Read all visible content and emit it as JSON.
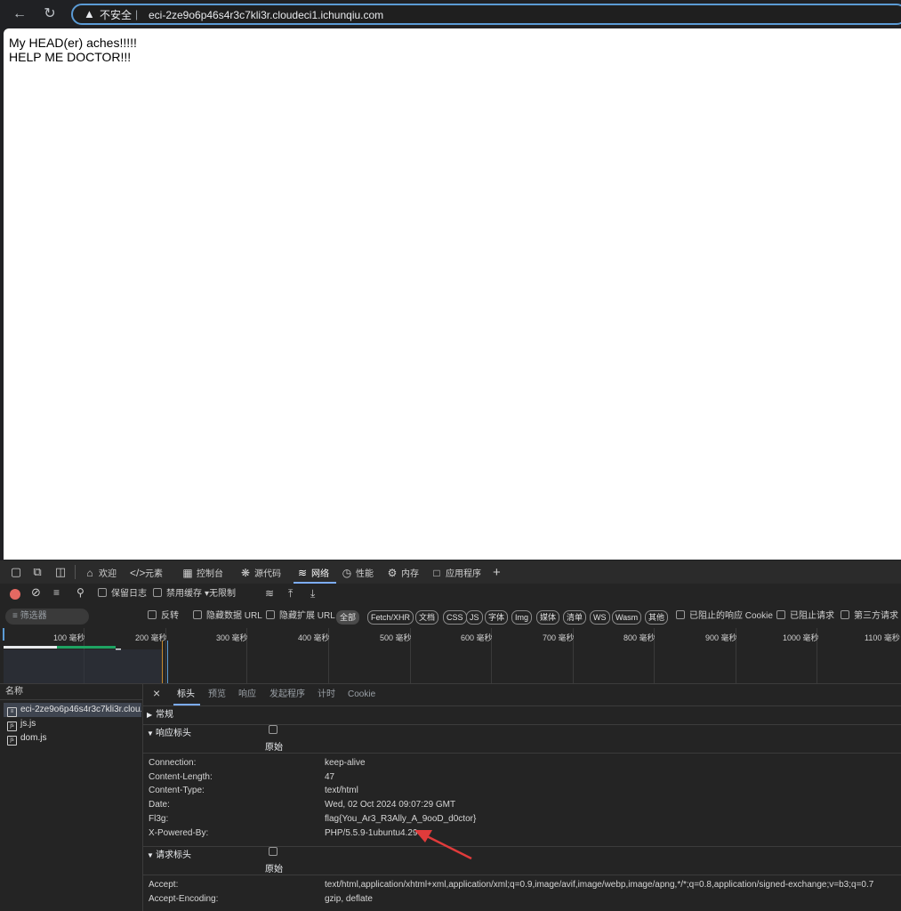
{
  "browser": {
    "security_label": "不安全",
    "separator": "|",
    "url": "eci-2ze9o6p46s4r3c7kli3r.cloudeci1.ichunqiu.com"
  },
  "page": {
    "lines": [
      "My HEAD(er) aches!!!!!",
      "HELP ME DOCTOR!!!"
    ]
  },
  "devtools": {
    "tabs": [
      {
        "label": "欢迎",
        "icon": "home-icon"
      },
      {
        "label": "元素",
        "icon": "code-icon"
      },
      {
        "label": "控制台",
        "icon": "console-icon"
      },
      {
        "label": "源代码",
        "icon": "bug-icon"
      },
      {
        "label": "网络",
        "icon": "wifi-icon"
      },
      {
        "label": "性能",
        "icon": "gauge-icon"
      },
      {
        "label": "内存",
        "icon": "gear-icon"
      },
      {
        "label": "应用程序",
        "icon": "app-window-icon"
      }
    ],
    "toolbar": {
      "preserve_log": "保留日志",
      "disable_cache": "禁用缓存",
      "throttling": "无限制"
    },
    "filter": {
      "placeholder": "筛选器",
      "invert": "反转",
      "hide_data_urls": "隐藏数据 URL",
      "hide_ext_urls": "隐藏扩展 URL",
      "types": [
        "全部",
        "Fetch/XHR",
        "文档",
        "CSS",
        "JS",
        "字体",
        "Img",
        "媒体",
        "清单",
        "WS",
        "Wasm",
        "其他"
      ],
      "blocked_cookies": "已阻止的响应 Cookie",
      "blocked_requests": "已阻止请求",
      "third_party": "第三方请求"
    },
    "timeline_ticks": [
      "100 毫秒",
      "200 毫秒",
      "300 毫秒",
      "400 毫秒",
      "500 毫秒",
      "600 毫秒",
      "700 毫秒",
      "800 毫秒",
      "900 毫秒",
      "1000 毫秒",
      "1100 毫秒"
    ],
    "requests": {
      "column_name": "名称",
      "items": [
        "eci-2ze9o6p46s4r3c7kli3r.clou...",
        "js.js",
        "dom.js"
      ]
    },
    "details": {
      "tabs": [
        "标头",
        "预览",
        "响应",
        "发起程序",
        "计时",
        "Cookie"
      ],
      "general": "常规",
      "response_headers": "响应标头",
      "request_headers": "请求标头",
      "raw": "原始",
      "response": [
        {
          "name": "Connection:",
          "value": "keep-alive"
        },
        {
          "name": "Content-Length:",
          "value": "47"
        },
        {
          "name": "Content-Type:",
          "value": "text/html"
        },
        {
          "name": "Date:",
          "value": "Wed, 02 Oct 2024 09:07:29 GMT"
        },
        {
          "name": "Fl3g:",
          "value": "flag{You_Ar3_R3Ally_A_9ooD_d0ctor}"
        },
        {
          "name": "X-Powered-By:",
          "value": "PHP/5.5.9-1ubuntu4.29"
        }
      ],
      "request": [
        {
          "name": "Accept:",
          "value": "text/html,application/xhtml+xml,application/xml;q=0.9,image/avif,image/webp,image/apng,*/*;q=0.8,application/signed-exchange;v=b3;q=0.7"
        },
        {
          "name": "Accept-Encoding:",
          "value": "gzip, deflate"
        }
      ]
    }
  },
  "annotation": {
    "arrow_color": "#e03b3b"
  }
}
